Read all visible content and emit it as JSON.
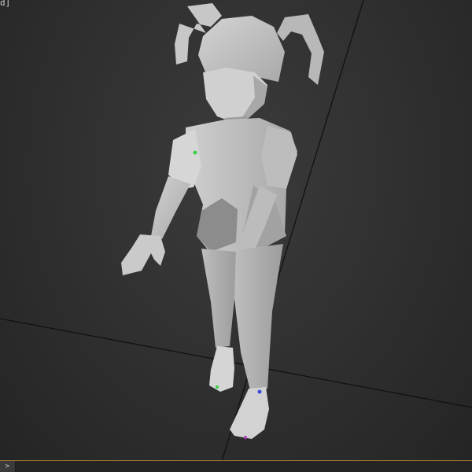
{
  "viewport": {
    "label": "d]",
    "background": "#333333",
    "grid_color": "#0f0f0f",
    "model": {
      "name": "character-model",
      "shading": "smooth-grey",
      "base_color": "#c8c8c8"
    }
  },
  "statusbar": {
    "prompt_button_label": ">",
    "prompt_value": "",
    "accent_color": "#a0782e"
  }
}
